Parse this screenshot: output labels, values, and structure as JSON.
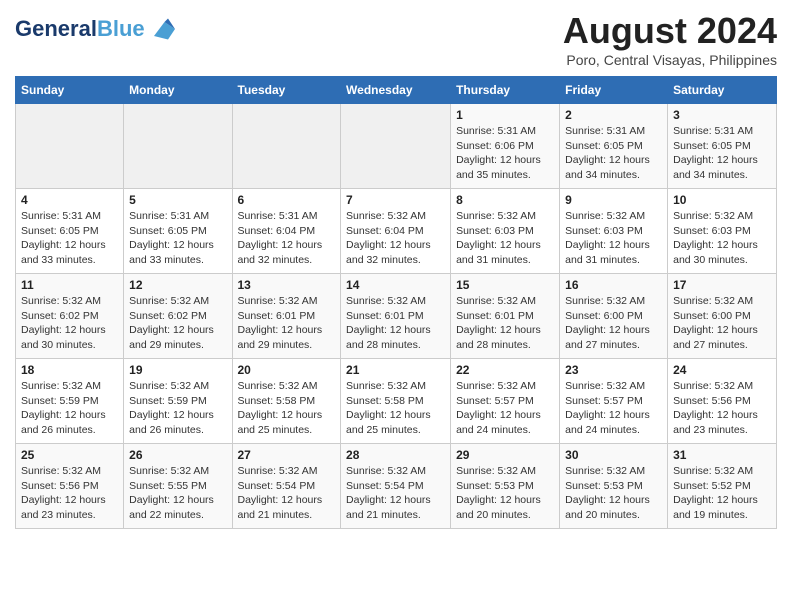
{
  "header": {
    "logo_line1": "General",
    "logo_line2": "Blue",
    "title": "August 2024",
    "location": "Poro, Central Visayas, Philippines"
  },
  "days_of_week": [
    "Sunday",
    "Monday",
    "Tuesday",
    "Wednesday",
    "Thursday",
    "Friday",
    "Saturday"
  ],
  "weeks": [
    [
      {
        "day": "",
        "info": ""
      },
      {
        "day": "",
        "info": ""
      },
      {
        "day": "",
        "info": ""
      },
      {
        "day": "",
        "info": ""
      },
      {
        "day": "1",
        "info": "Sunrise: 5:31 AM\nSunset: 6:06 PM\nDaylight: 12 hours\nand 35 minutes."
      },
      {
        "day": "2",
        "info": "Sunrise: 5:31 AM\nSunset: 6:05 PM\nDaylight: 12 hours\nand 34 minutes."
      },
      {
        "day": "3",
        "info": "Sunrise: 5:31 AM\nSunset: 6:05 PM\nDaylight: 12 hours\nand 34 minutes."
      }
    ],
    [
      {
        "day": "4",
        "info": "Sunrise: 5:31 AM\nSunset: 6:05 PM\nDaylight: 12 hours\nand 33 minutes."
      },
      {
        "day": "5",
        "info": "Sunrise: 5:31 AM\nSunset: 6:05 PM\nDaylight: 12 hours\nand 33 minutes."
      },
      {
        "day": "6",
        "info": "Sunrise: 5:31 AM\nSunset: 6:04 PM\nDaylight: 12 hours\nand 32 minutes."
      },
      {
        "day": "7",
        "info": "Sunrise: 5:32 AM\nSunset: 6:04 PM\nDaylight: 12 hours\nand 32 minutes."
      },
      {
        "day": "8",
        "info": "Sunrise: 5:32 AM\nSunset: 6:03 PM\nDaylight: 12 hours\nand 31 minutes."
      },
      {
        "day": "9",
        "info": "Sunrise: 5:32 AM\nSunset: 6:03 PM\nDaylight: 12 hours\nand 31 minutes."
      },
      {
        "day": "10",
        "info": "Sunrise: 5:32 AM\nSunset: 6:03 PM\nDaylight: 12 hours\nand 30 minutes."
      }
    ],
    [
      {
        "day": "11",
        "info": "Sunrise: 5:32 AM\nSunset: 6:02 PM\nDaylight: 12 hours\nand 30 minutes."
      },
      {
        "day": "12",
        "info": "Sunrise: 5:32 AM\nSunset: 6:02 PM\nDaylight: 12 hours\nand 29 minutes."
      },
      {
        "day": "13",
        "info": "Sunrise: 5:32 AM\nSunset: 6:01 PM\nDaylight: 12 hours\nand 29 minutes."
      },
      {
        "day": "14",
        "info": "Sunrise: 5:32 AM\nSunset: 6:01 PM\nDaylight: 12 hours\nand 28 minutes."
      },
      {
        "day": "15",
        "info": "Sunrise: 5:32 AM\nSunset: 6:01 PM\nDaylight: 12 hours\nand 28 minutes."
      },
      {
        "day": "16",
        "info": "Sunrise: 5:32 AM\nSunset: 6:00 PM\nDaylight: 12 hours\nand 27 minutes."
      },
      {
        "day": "17",
        "info": "Sunrise: 5:32 AM\nSunset: 6:00 PM\nDaylight: 12 hours\nand 27 minutes."
      }
    ],
    [
      {
        "day": "18",
        "info": "Sunrise: 5:32 AM\nSunset: 5:59 PM\nDaylight: 12 hours\nand 26 minutes."
      },
      {
        "day": "19",
        "info": "Sunrise: 5:32 AM\nSunset: 5:59 PM\nDaylight: 12 hours\nand 26 minutes."
      },
      {
        "day": "20",
        "info": "Sunrise: 5:32 AM\nSunset: 5:58 PM\nDaylight: 12 hours\nand 25 minutes."
      },
      {
        "day": "21",
        "info": "Sunrise: 5:32 AM\nSunset: 5:58 PM\nDaylight: 12 hours\nand 25 minutes."
      },
      {
        "day": "22",
        "info": "Sunrise: 5:32 AM\nSunset: 5:57 PM\nDaylight: 12 hours\nand 24 minutes."
      },
      {
        "day": "23",
        "info": "Sunrise: 5:32 AM\nSunset: 5:57 PM\nDaylight: 12 hours\nand 24 minutes."
      },
      {
        "day": "24",
        "info": "Sunrise: 5:32 AM\nSunset: 5:56 PM\nDaylight: 12 hours\nand 23 minutes."
      }
    ],
    [
      {
        "day": "25",
        "info": "Sunrise: 5:32 AM\nSunset: 5:56 PM\nDaylight: 12 hours\nand 23 minutes."
      },
      {
        "day": "26",
        "info": "Sunrise: 5:32 AM\nSunset: 5:55 PM\nDaylight: 12 hours\nand 22 minutes."
      },
      {
        "day": "27",
        "info": "Sunrise: 5:32 AM\nSunset: 5:54 PM\nDaylight: 12 hours\nand 21 minutes."
      },
      {
        "day": "28",
        "info": "Sunrise: 5:32 AM\nSunset: 5:54 PM\nDaylight: 12 hours\nand 21 minutes."
      },
      {
        "day": "29",
        "info": "Sunrise: 5:32 AM\nSunset: 5:53 PM\nDaylight: 12 hours\nand 20 minutes."
      },
      {
        "day": "30",
        "info": "Sunrise: 5:32 AM\nSunset: 5:53 PM\nDaylight: 12 hours\nand 20 minutes."
      },
      {
        "day": "31",
        "info": "Sunrise: 5:32 AM\nSunset: 5:52 PM\nDaylight: 12 hours\nand 19 minutes."
      }
    ]
  ]
}
